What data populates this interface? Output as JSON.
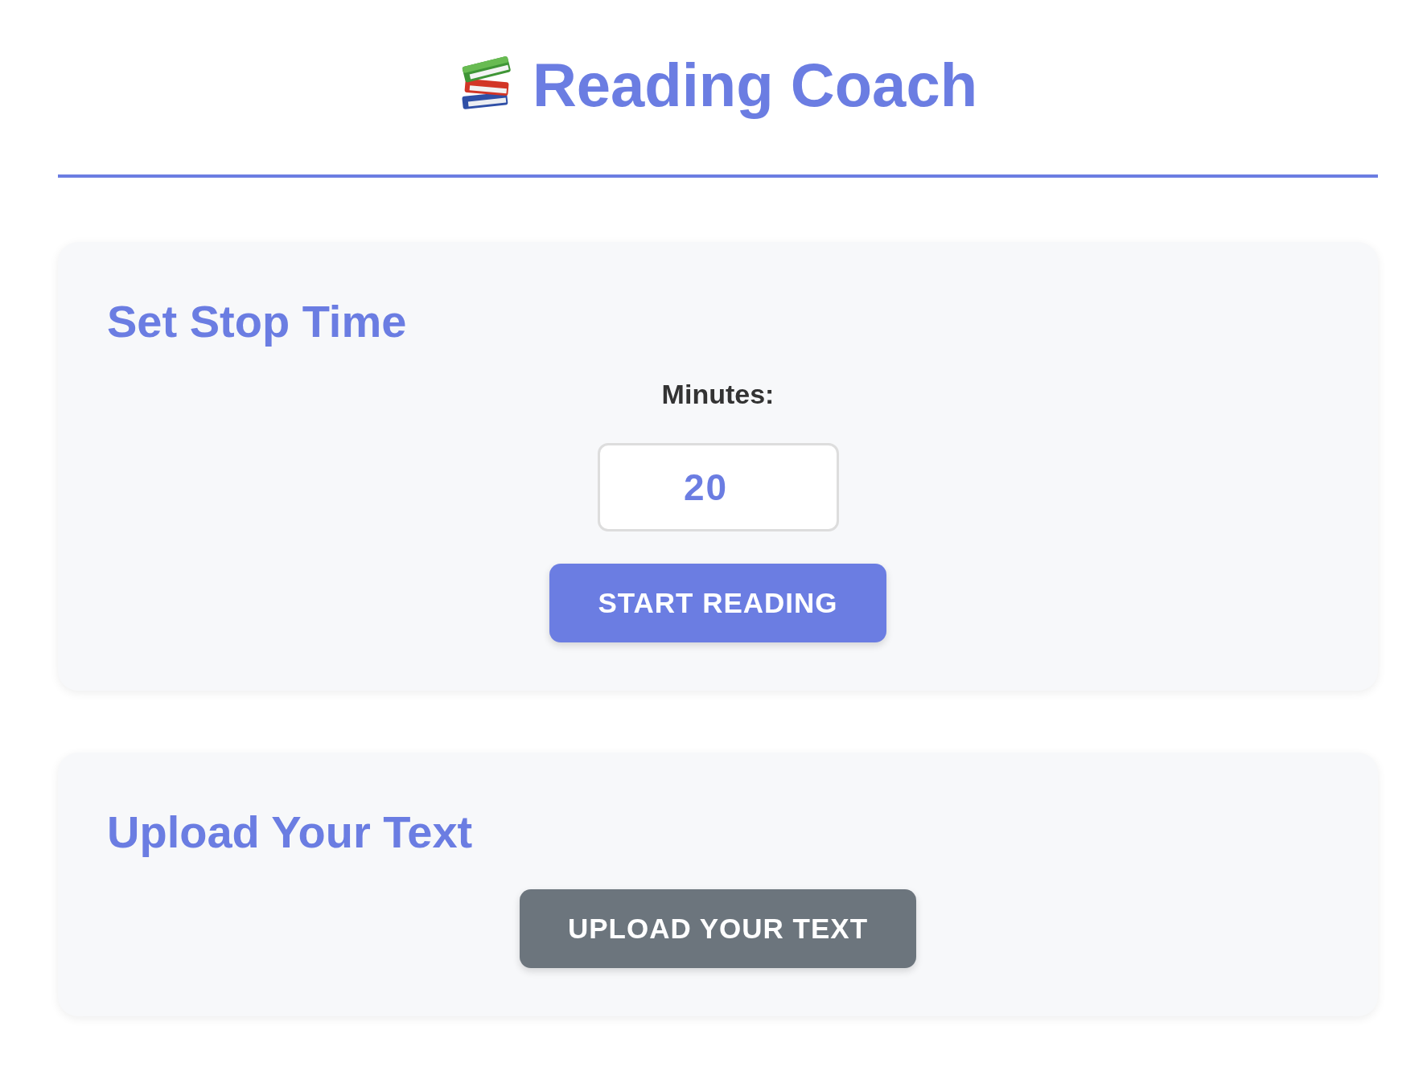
{
  "header": {
    "title": "Reading Coach"
  },
  "sections": [
    {
      "heading": "Set Stop Time",
      "field": {
        "label": "Minutes:",
        "value": "20"
      },
      "button": {
        "label": "START READING",
        "kind": "primary"
      }
    },
    {
      "heading": "Upload Your Text",
      "button": {
        "label": "UPLOAD YOUR TEXT",
        "kind": "secondary"
      }
    }
  ]
}
